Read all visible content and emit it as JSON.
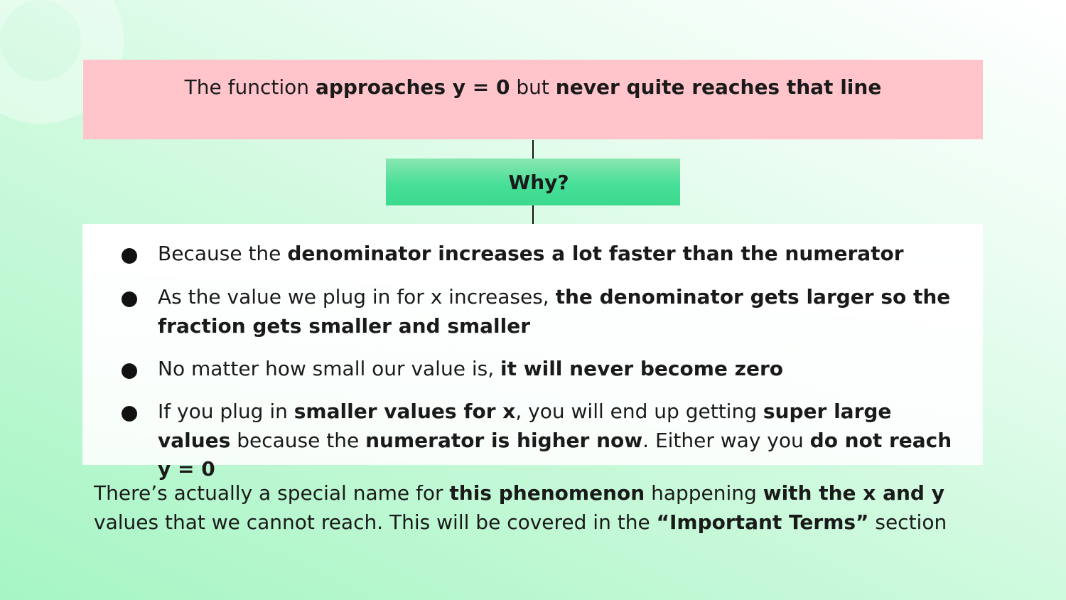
{
  "top_statement": {
    "part1": "The function ",
    "part2": "approaches y = 0",
    "part3": " but ",
    "part4": "never quite reaches that line"
  },
  "why_label": "Why?",
  "reasons": [
    {
      "t1": "Because the ",
      "b1": "denominator increases a lot faster than the numerator"
    },
    {
      "t1": "As the value we plug in for x increases, ",
      "b1": "the denominator gets larger so the fraction gets smaller and smaller"
    },
    {
      "t1": "No matter how small our value is, ",
      "b1": "it will never become zero"
    },
    {
      "t1": "If you plug in ",
      "b1": "smaller values for x",
      "t2": ", you will end up getting ",
      "b2": "super large values",
      "t3": " because the ",
      "b3": "numerator is higher now",
      "t4": ". Either way you ",
      "b4": "do not reach y = 0"
    }
  ],
  "footer": {
    "t1": "There’s actually a special name for ",
    "b1": "this phenomenon",
    "t2": " happening ",
    "b2": "with the x and y",
    "t3": " values that we cannot reach. This will be covered in the ",
    "b3": "“Important Terms”",
    "t4": " section"
  },
  "colors": {
    "top_box": "#ffc5cb",
    "why_box": "#48df98",
    "background_light": "#ffffff",
    "background_green": "#a6f5c4"
  }
}
